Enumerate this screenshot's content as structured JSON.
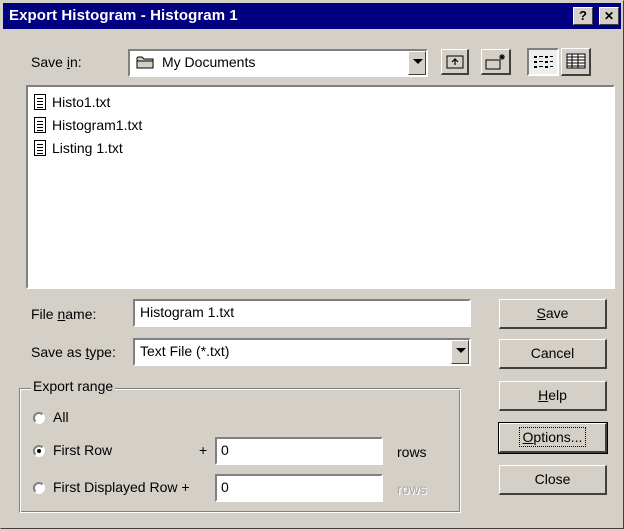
{
  "window": {
    "title": "Export Histogram - Histogram 1",
    "help_glyph": "?",
    "close_glyph": "✕"
  },
  "save_in": {
    "label_pre": "Save ",
    "label_accel": "i",
    "label_post": "n:",
    "value": "My Documents"
  },
  "files": [
    {
      "name": "Histo1.txt"
    },
    {
      "name": "Histogram1.txt"
    },
    {
      "name": "Listing 1.txt"
    }
  ],
  "file_name": {
    "label_pre": "File ",
    "label_accel": "n",
    "label_post": "ame:",
    "value": "Histogram 1.txt"
  },
  "save_as_type": {
    "label_pre": "Save as ",
    "label_accel": "t",
    "label_post": "ype:",
    "value": "Text File (*.txt)"
  },
  "buttons": {
    "save_accel": "S",
    "save_rest": "ave",
    "cancel": "Cancel",
    "help_accel": "H",
    "help_rest": "elp",
    "options_accel": "O",
    "options_rest": "ptions...",
    "close": "Close"
  },
  "export_range": {
    "legend": "Export range",
    "all": "All",
    "first_row": "First Row",
    "first_row_plus": "+",
    "first_row_value": "0",
    "first_row_unit": "rows",
    "first_displayed_row": "First Displayed Row +",
    "first_displayed_value": "0",
    "first_displayed_unit": "rows"
  },
  "colors": {
    "titlebar": "#000080",
    "face": "#d4d0c8",
    "disabled_text": "#808080"
  }
}
